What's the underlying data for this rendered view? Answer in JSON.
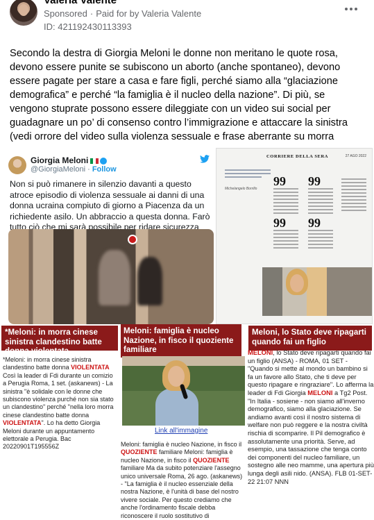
{
  "post": {
    "author": "Valeria Valente",
    "sponsored_label": "Sponsored",
    "separator": "·",
    "paid_for_by": "Paid for by Valeria Valente",
    "ad_id": "ID: 421192430113393",
    "body": "Secondo la destra di Giorgia Meloni le donne non meritano le quote rosa, devono essere punite se subiscono un aborto (anche spontaneo), devono essere pagate per stare a casa e fare figli, perché siamo alla “glaciazione demografica” e perché “la famiglia è il nucleo della nazione”. Di più, se vengono stuprate possono essere dileggiate con un video sui social per guadagnare un po’ di consenso contro l’immigrazione e attaccare la sinistra (vedi orrore del video sulla violenza sessuale e frase aberrante su morra cinese)...."
  },
  "tweet": {
    "name": "Giorgia Meloni",
    "handle": "@GiorgiaMeloni",
    "dot": "·",
    "follow": "Follow",
    "text": "Non si può rimanere in silenzio davanti a questo atroce episodio di violenza sessuale ai danni di una donna ucraina compiuto di giorno a Piacenza da un richiedente asilo. Un abbraccio a questa donna. Farò tutto ciò che mi sarà possibile per ridare sicurezza alle nostre città."
  },
  "newspaper": {
    "masthead": "CORRIERE DELLA SERA",
    "date": "27 AGO 2022",
    "byline": "Michelangelo Borrillo"
  },
  "articles": {
    "a1": {
      "headline": "*Meloni: in morra cinese sinistra clandestino batte donna violentata",
      "p1": "*Meloni: in morra cinese sinistra clandestino batte donna ",
      "h1": "VIOLENTATA",
      "p2": " Così la leader di Fdi durante un comizio a Perugia Roma, 1 set. (askanews) - La sinistra \"è solidale con le donne che subiscono violenza purché non sia stato un clandestino\" perché \"nella loro morra cinese clandestino batte donna ",
      "h2": "VIOLENTATA",
      "p3": "\". Lo ha detto Giorgia Meloni durante un appuntamento elettorale a Perugia. Bac 20220901T195556Z"
    },
    "a2": {
      "headline": "Meloni: famiglia è nucleo Nazione, in fisco il quoziente familiare",
      "link": "Link all'immagine",
      "p1": "Meloni: famiglia è nucleo Nazione, in fisco il ",
      "h1": "QUOZIENTE",
      "p2": " familiare Meloni: famiglia è nucleo Nazione, in fisco il ",
      "h2": "QUOZIENTE",
      "p3": " familiare Ma da subito potenziare l'assegno unico universale Roma, 26 ago. (askanews) - \"La famiglia è il nucleo essenziale della nostra Nazione, è l'unità di base del nostro vivere sociale. Per questo crediamo che anche l'ordinamento fiscale debba riconoscere il ruolo sostitutivo di"
    },
    "a3": {
      "headline": "Meloni, lo Stato deve ripagarti quando fai un figlio",
      "h1": "MELONI",
      "p1": ", lo Stato deve ripagarti quando fai un figlio (ANSA) - ROMA, 01 SET - \"Quando si mette al mondo un bambino si fa un favore allo Stato, che ti deve per questo ripagare e ringraziare\". Lo afferma la leader di Fdi Giorgia ",
      "h2": "MELONI",
      "p2": " a Tg2 Post. \"In Italia - sosiene - non siamo all'inverno demografico, siamo alla glaciazione. Se andiamo avanti così il nostro sistema di welfare non può reggere e la nostra civiltà rischia di scomparire. Il Pil demografico è assolutamente una priorità. Serve, ad esempio, una tassazione che tenga conto dei componenti del nucleo familiare, un sostegno alle neo mamme, una apertura più lunga degli asili nido. (ANSA). FLB 01-SET-22 21:07 NNN"
    }
  },
  "icons": {
    "more": "more-horizontal-icon",
    "twitter": "twitter-bird-icon",
    "verified": "verified-badge-icon",
    "no_entry_sign": "no-entry-sign-icon"
  },
  "colors": {
    "headline_red": "#8b1a1a",
    "highlight_red": "#cc1111",
    "link_blue": "#1f3fb3",
    "twitter_blue": "#1da1f2"
  }
}
